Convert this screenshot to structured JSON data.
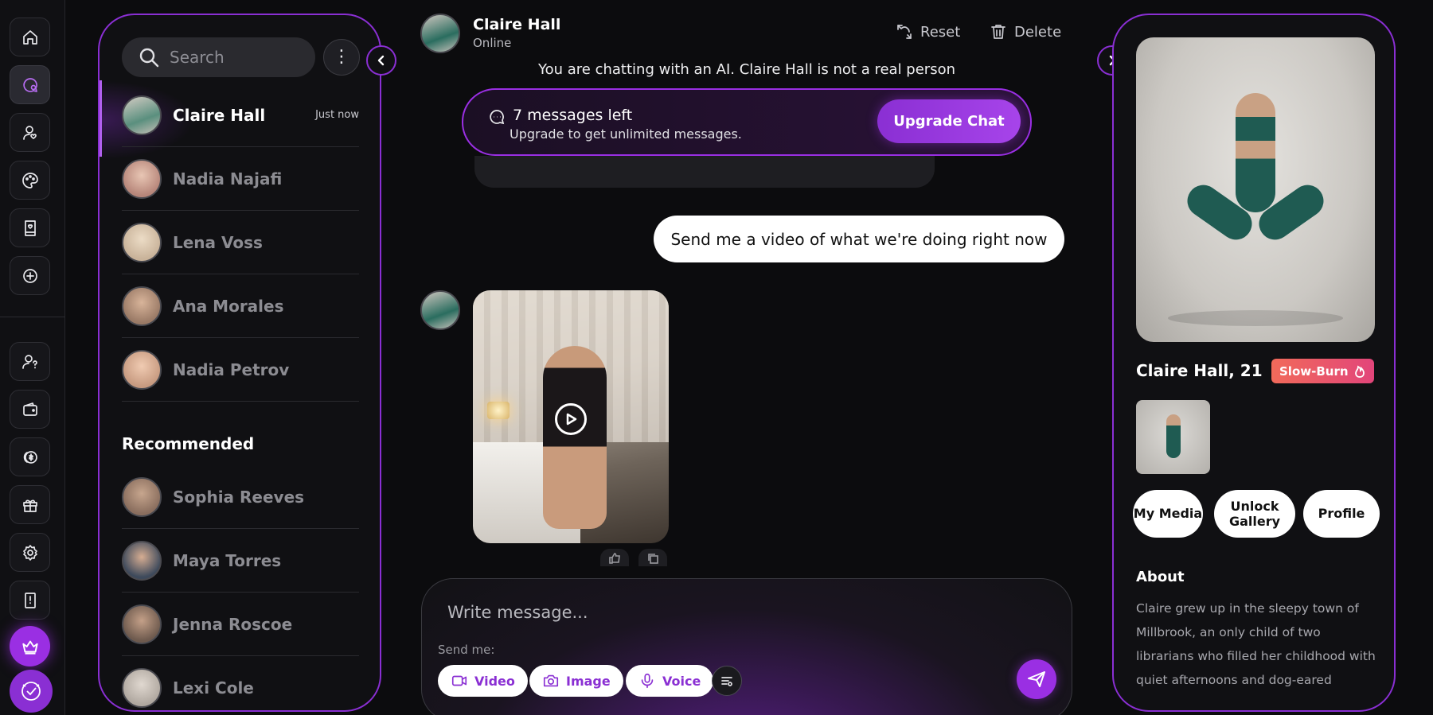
{
  "nav": {
    "icons": [
      "home-icon",
      "chat-icon",
      "user-heart-icon",
      "palette-icon",
      "book-heart-icon",
      "plus-circle-icon",
      "user-help-icon",
      "wallet-icon",
      "coins-icon",
      "gift-icon",
      "settings-icon",
      "guide-icon",
      "crown-icon",
      "badge-check-icon"
    ]
  },
  "chat_list": {
    "search_placeholder": "Search",
    "chats": [
      {
        "name": "Claire Hall",
        "time": "Just now",
        "active": true,
        "avatar_color": "#5a8f7e"
      },
      {
        "name": "Nadia Najafi",
        "time": "",
        "active": false,
        "avatar_color": "#b7867a"
      },
      {
        "name": "Lena Voss",
        "time": "",
        "active": false,
        "avatar_color": "#c9b39a"
      },
      {
        "name": "Ana Morales",
        "time": "",
        "active": false,
        "avatar_color": "#9a7a66"
      },
      {
        "name": "Nadia Petrov",
        "time": "",
        "active": false,
        "avatar_color": "#c79a80"
      }
    ],
    "recommended_title": "Recommended",
    "recommended": [
      {
        "name": "Sophia Reeves",
        "avatar_color": "#8a6e5e"
      },
      {
        "name": "Maya Torres",
        "avatar_color": "#3e4a5c"
      },
      {
        "name": "Jenna Roscoe",
        "avatar_color": "#6e5a4e"
      },
      {
        "name": "Lexi Cole",
        "avatar_color": "#b0a8a0"
      }
    ]
  },
  "header": {
    "name": "Claire Hall",
    "status": "Online",
    "reset_label": "Reset",
    "delete_label": "Delete"
  },
  "disclaimer": "You are chatting with an AI. Claire Hall is not a real person",
  "limit": {
    "title": "7 messages left",
    "subtitle": "Upgrade to get unlimited messages.",
    "button": "Upgrade Chat"
  },
  "messages": {
    "user": "Send me a video of what we're doing right now"
  },
  "composer": {
    "placeholder": "Write message...",
    "send_me_label": "Send me:",
    "chips": [
      "Video",
      "Image",
      "Voice"
    ]
  },
  "profile": {
    "name": "Claire Hall, 21",
    "tag": "Slow-Burn",
    "buttons": [
      "My Media",
      "Unlock Gallery",
      "Profile"
    ],
    "about_title": "About",
    "about_text": "Claire grew up in the sleepy town of Millbrook, an only child of two librarians who filled her childhood with quiet afternoons and dog-eared"
  },
  "colors": {
    "accent": "#8a2fd3",
    "background": "#0c0c0e",
    "panel": "#101013",
    "tag_gradient_start": "#f16a5a",
    "tag_gradient_end": "#e2457a"
  }
}
